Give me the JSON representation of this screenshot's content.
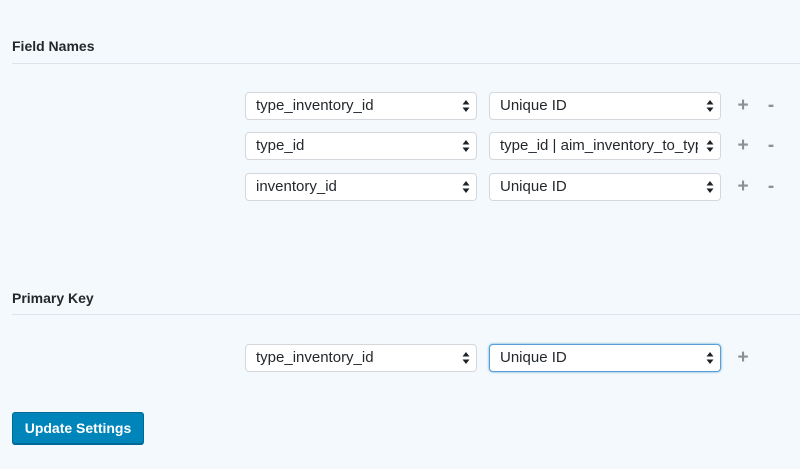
{
  "field_names": {
    "title": "Field Names",
    "rows": [
      {
        "field": "type_inventory_id",
        "source": "Unique ID"
      },
      {
        "field": "type_id",
        "source": "type_id | aim_inventory_to_type"
      },
      {
        "field": "inventory_id",
        "source": "Unique ID"
      }
    ]
  },
  "primary_key": {
    "title": "Primary Key",
    "rows": [
      {
        "field": "type_inventory_id",
        "source": "Unique ID"
      }
    ]
  },
  "controls": {
    "add_label": "+",
    "remove_label": "-"
  },
  "update_button_label": "Update Settings"
}
